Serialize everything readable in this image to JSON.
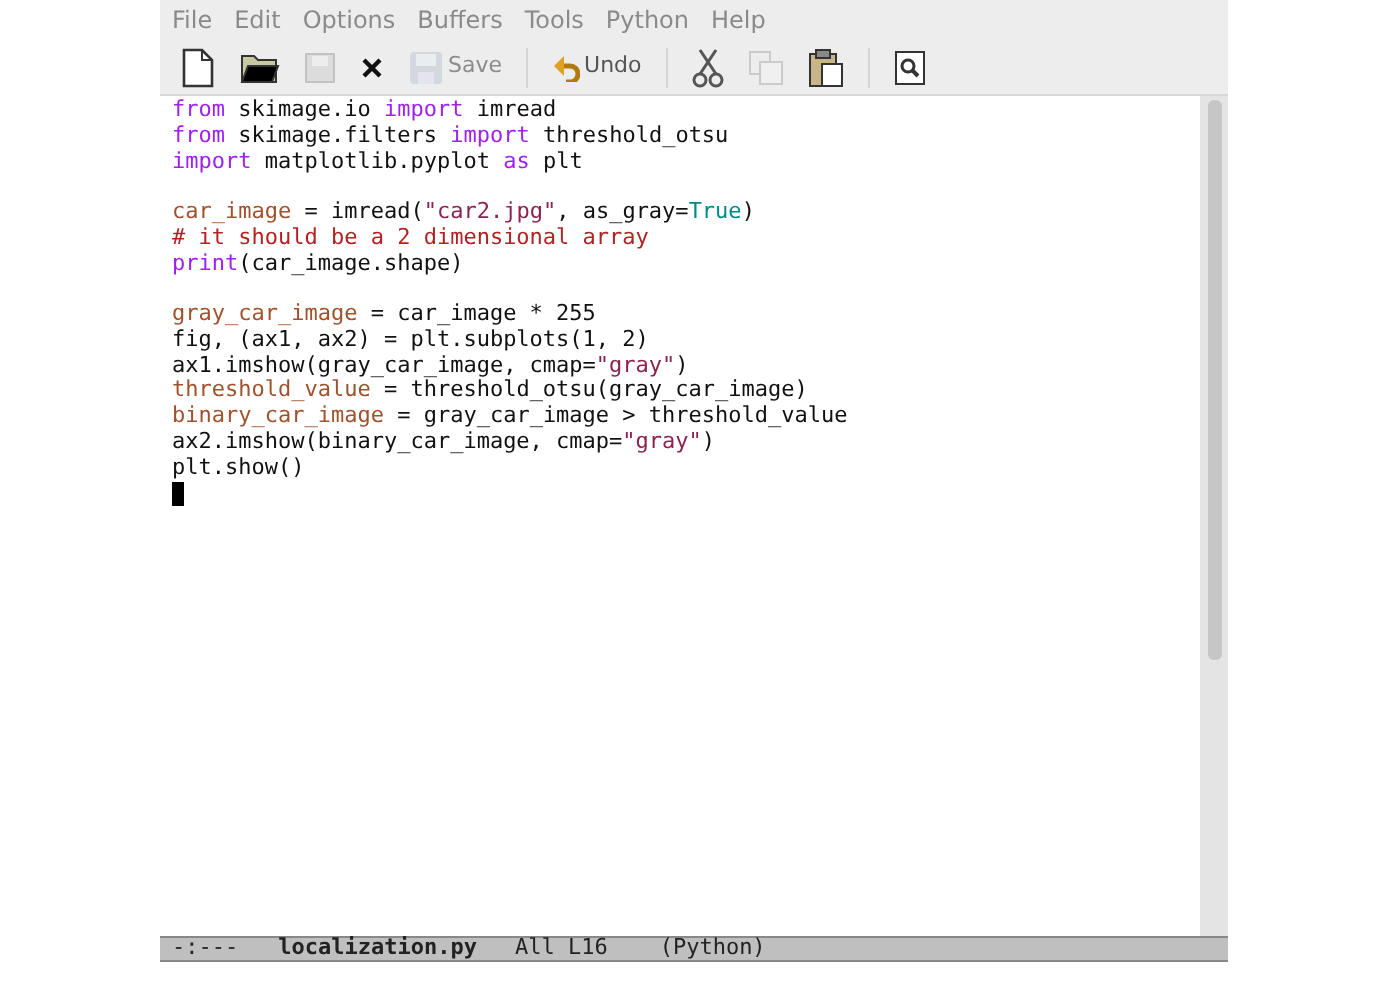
{
  "menu_bar": [
    "File",
    "Edit",
    "Options",
    "Buffers",
    "Tools",
    "Python",
    "Help"
  ],
  "toolbar": [
    {
      "disabled": false
    },
    {
      "disabled": false
    },
    {
      "disabled": true
    },
    {
      "disabled": false
    },
    {
      "disabled": true,
      "label": "Save"
    },
    {
      "disabled": false,
      "label": "Undo"
    },
    {
      "disabled": false
    },
    {
      "disabled": true
    },
    {
      "disabled": false
    },
    {
      "disabled": false
    }
  ],
  "editor": {
    "lines": [
      {
        "kind": "code",
        "tokens": [
          {
            "kind": "keyword",
            "text": "from"
          },
          {
            "kind": "plain",
            "text": " skimage.io "
          },
          {
            "kind": "keyword",
            "text": "import"
          },
          {
            "kind": "plain",
            "text": " imread"
          }
        ]
      },
      {
        "kind": "code",
        "tokens": [
          {
            "kind": "keyword",
            "text": "from"
          },
          {
            "kind": "plain",
            "text": " skimage.filters "
          },
          {
            "kind": "keyword",
            "text": "import"
          },
          {
            "kind": "plain",
            "text": " threshold_otsu"
          }
        ]
      },
      {
        "kind": "code",
        "tokens": [
          {
            "kind": "keyword",
            "text": "import"
          },
          {
            "kind": "plain",
            "text": " matplotlib.pyplot "
          },
          {
            "kind": "keyword",
            "text": "as"
          },
          {
            "kind": "plain",
            "text": " plt"
          }
        ]
      },
      {
        "kind": "blank"
      },
      {
        "kind": "code",
        "tokens": [
          {
            "kind": "variable",
            "text": "car_image"
          },
          {
            "kind": "plain",
            "text": " = imread("
          },
          {
            "kind": "string",
            "text": "\"car2.jpg\""
          },
          {
            "kind": "plain",
            "text": ", as_gray="
          },
          {
            "kind": "constant",
            "text": "True"
          },
          {
            "kind": "plain",
            "text": ")"
          }
        ]
      },
      {
        "kind": "code",
        "tokens": [
          {
            "kind": "comment",
            "text": "# it should be a 2 dimensional array"
          }
        ]
      },
      {
        "kind": "code",
        "tokens": [
          {
            "kind": "builtin",
            "text": "print"
          },
          {
            "kind": "plain",
            "text": "(car_image.shape)"
          }
        ]
      },
      {
        "kind": "blank"
      },
      {
        "kind": "code",
        "tokens": [
          {
            "kind": "variable",
            "text": "gray_car_image"
          },
          {
            "kind": "plain",
            "text": " = car_image * 255"
          }
        ]
      },
      {
        "kind": "code",
        "tokens": [
          {
            "kind": "plain",
            "text": "fig, (ax1, ax2) = plt.subplots(1, 2)"
          }
        ]
      },
      {
        "kind": "code",
        "tokens": [
          {
            "kind": "plain",
            "text": "ax1.imshow(gray_car_image, cmap="
          },
          {
            "kind": "string",
            "text": "\"gray\""
          },
          {
            "kind": "plain",
            "text": ")"
          }
        ]
      },
      {
        "kind": "code",
        "tokens": [
          {
            "kind": "variable",
            "text": "threshold_value"
          },
          {
            "kind": "plain",
            "text": " = threshold_otsu(gray_car_image)"
          }
        ]
      },
      {
        "kind": "code",
        "tokens": [
          {
            "kind": "variable",
            "text": "binary_car_image"
          },
          {
            "kind": "plain",
            "text": " = gray_car_image > threshold_value"
          }
        ]
      },
      {
        "kind": "code",
        "tokens": [
          {
            "kind": "plain",
            "text": "ax2.imshow(binary_car_image, cmap="
          },
          {
            "kind": "string",
            "text": "\"gray\""
          },
          {
            "kind": "plain",
            "text": ")"
          }
        ]
      },
      {
        "kind": "code",
        "tokens": [
          {
            "kind": "plain",
            "text": "plt.show()"
          }
        ]
      },
      {
        "kind": "cursor"
      }
    ]
  },
  "mode_line": {
    "status": "-:---",
    "buffer": "localization.py",
    "position": "All L16",
    "mode": "(Python)"
  }
}
